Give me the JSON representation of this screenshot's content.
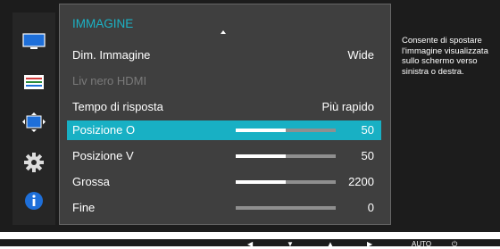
{
  "sidebar": {
    "icons": [
      {
        "name": "monitor-icon",
        "color": "#1e6fd9"
      },
      {
        "name": "picture-settings-icon"
      },
      {
        "name": "screen-move-icon"
      },
      {
        "name": "gear-icon"
      },
      {
        "name": "info-icon",
        "color": "#1e6fd9"
      }
    ]
  },
  "menu": {
    "title": "IMMAGINE",
    "rows": [
      {
        "label": "Dim. Immagine",
        "value": "Wide"
      },
      {
        "label": "Liv nero HDMI",
        "value": "",
        "disabled": true
      },
      {
        "label": "Tempo di risposta",
        "value": "Più rapido"
      },
      {
        "label": "Posizione O",
        "value": "50",
        "bar": 0.5,
        "selected": true
      },
      {
        "label": "Posizione V",
        "value": "50",
        "bar": 0.5
      },
      {
        "label": "Grossa",
        "value": "2200",
        "bar": 0.5
      },
      {
        "label": "Fine",
        "value": "0",
        "bar": 0.0
      }
    ]
  },
  "help_text": "Consente di spostare l'immagine visualizzata sullo schermo verso sinistra o destra.",
  "bottom_bar": {
    "buttons": [
      "◀",
      "▼",
      "▲",
      "▶",
      "AUTO",
      "⏻"
    ]
  },
  "colors": {
    "accent": "#18b0c4",
    "title": "#1bb3c6"
  }
}
